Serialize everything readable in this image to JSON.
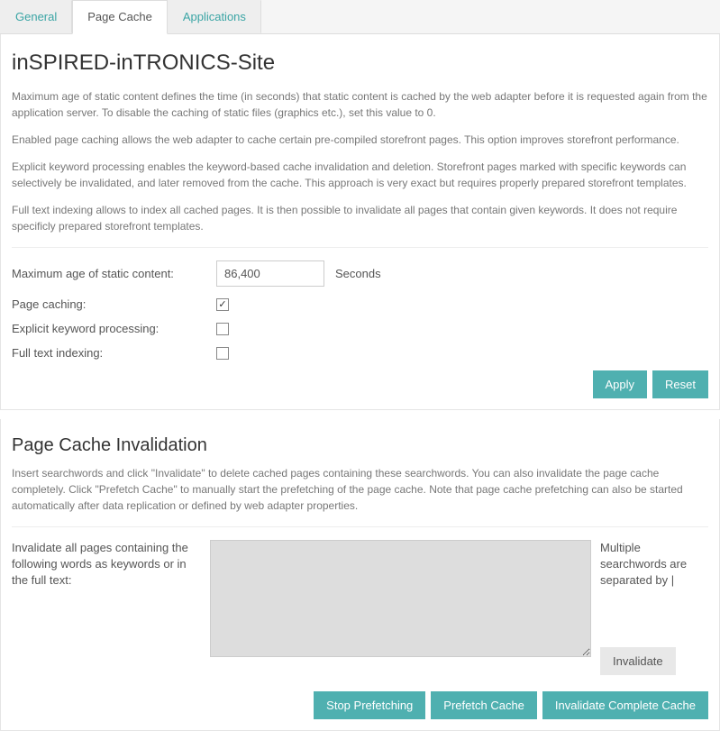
{
  "tabs": {
    "general": "General",
    "page_cache": "Page Cache",
    "applications": "Applications"
  },
  "page_title": "inSPIRED-inTRONICS-Site",
  "descriptions": {
    "max_age": "Maximum age of static content defines the time (in seconds) that static content is cached by the web adapter before it is requested again from the application server. To disable the caching of static files (graphics etc.), set this value to 0.",
    "page_caching": "Enabled page caching allows the web adapter to cache certain pre-compiled storefront pages. This option improves storefront performance.",
    "explicit": "Explicit keyword processing enables the keyword-based cache invalidation and deletion. Storefront pages marked with specific keywords can selectively be invalidated, and later removed from the cache. This approach is very exact but requires properly prepared storefront templates.",
    "fulltext": "Full text indexing allows to index all cached pages. It is then possible to invalidate all pages that contain given keywords. It does not require specificly prepared storefront templates."
  },
  "form": {
    "max_age_label": "Maximum age of static content:",
    "max_age_value": "86,400",
    "max_age_suffix": "Seconds",
    "page_caching_label": "Page caching:",
    "page_caching_checked": "✓",
    "explicit_label": "Explicit keyword processing:",
    "fulltext_label": "Full text indexing:"
  },
  "buttons": {
    "apply": "Apply",
    "reset": "Reset",
    "stop_prefetching": "Stop Prefetching",
    "prefetch_cache": "Prefetch Cache",
    "invalidate_complete": "Invalidate Complete Cache",
    "invalidate": "Invalidate"
  },
  "invalidation": {
    "title": "Page Cache Invalidation",
    "description": "Insert searchwords and click \"Invalidate\" to delete cached pages containing these searchwords. You can also invalidate the page cache completely. Click \"Prefetch Cache\" to manually start the prefetching of the page cache. Note that page cache prefetching can also be started automatically after data replication or defined by web adapter properties.",
    "label": "Invalidate all pages containing the following words as keywords or in the full text:",
    "hint": "Multiple searchwords are separated by |"
  }
}
